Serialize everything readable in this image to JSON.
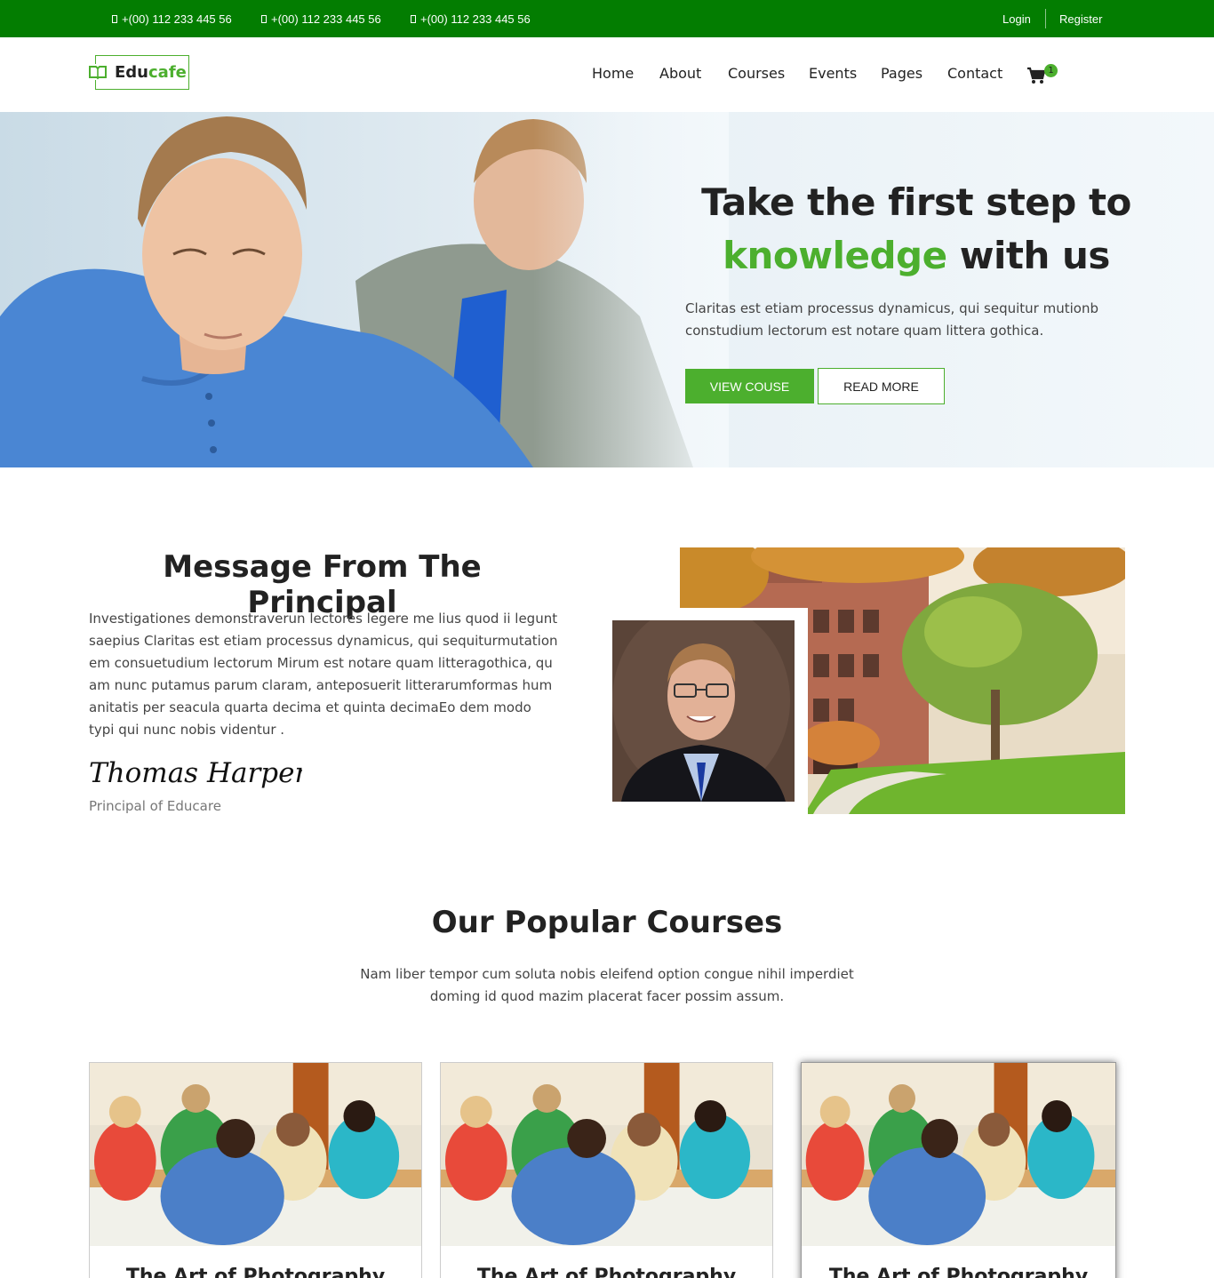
{
  "topbar": {
    "phones": [
      "+(00) 112 233 445 56",
      "+(00) 112 233 445 56",
      "+(00) 112 233 445 56"
    ],
    "login": "Login",
    "register": "Register"
  },
  "header": {
    "logo_part1": "Edu",
    "logo_part2": "cafe",
    "nav": [
      "Home",
      "About",
      "Courses",
      "Events",
      "Pages",
      "Contact"
    ],
    "cart_count": "1"
  },
  "hero": {
    "title_line1": "Take the first step to",
    "title_highlight": "knowledge",
    "title_rest": "with us",
    "text": "Claritas est etiam processus dynamicus, qui sequitur mutionb constudium lectorum est notare quam littera gothica.",
    "primary_button": "VIEW COUSE",
    "secondary_button": "READ MORE"
  },
  "principal": {
    "title": "Message From The Principal",
    "text": "Investigationes demonstraverun lectores legere me lius quod ii legunt saepius Claritas est etiam processus dynamicus, qui sequiturmutation em consuetudium lectorum Mirum est notare quam litteragothica, qu am nunc putamus parum claram, anteposuerit litterarumformas hum anitatis per seacula quarta decima et quinta decimaEo dem modo typi qui nunc nobis videntur .",
    "signature": "Thomas Harper",
    "role": "Principal of Educare"
  },
  "courses": {
    "title": "Our Popular Courses",
    "subtitle_line1": "Nam liber tempor cum soluta nobis eleifend option congue nihil imperdiet",
    "subtitle_line2": "doming id quod mazim placerat facer possim assum.",
    "items": [
      {
        "title": "The Art of Photography"
      },
      {
        "title": "The Art of Photography"
      },
      {
        "title": "The Art of Photography"
      }
    ]
  },
  "colors": {
    "topbar": "#037d01",
    "accent": "#4caf2e"
  }
}
